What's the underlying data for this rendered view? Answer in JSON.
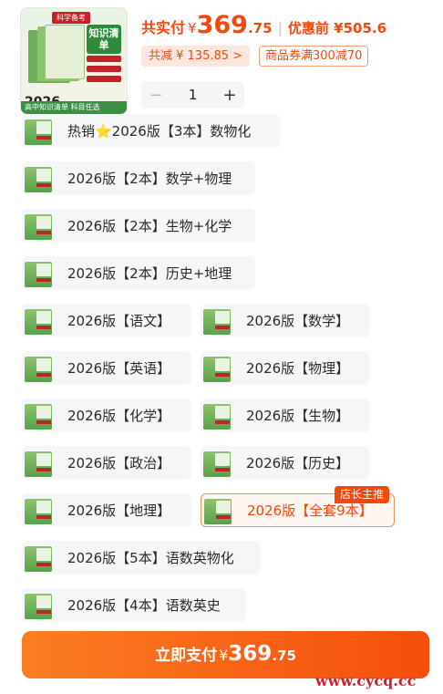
{
  "product": {
    "brand": "科学备考",
    "cover_title": "知识清单",
    "year": "2026",
    "strip_text": "高中知识清单 科目任选"
  },
  "price": {
    "label": "共实付",
    "currency": "¥",
    "integer": "369",
    "decimal": ".75",
    "separator": "|",
    "original_text": "优惠前 ¥505.6",
    "saved_text": "共减 ¥ 135.85 >",
    "coupon_text": "商品券满300减70"
  },
  "quantity": {
    "minus": "−",
    "value": "1",
    "plus": "+"
  },
  "options": [
    {
      "label": "热销⭐2026版【3本】数物化"
    },
    {
      "label": "2026版【2本】数学+物理"
    },
    {
      "label": "2026版【2本】生物+化学"
    },
    {
      "label": "2026版【2本】历史+地理"
    },
    {
      "label": "2026版【语文】"
    },
    {
      "label": "2026版【数学】"
    },
    {
      "label": "2026版【英语】"
    },
    {
      "label": "2026版【物理】"
    },
    {
      "label": "2026版【化学】"
    },
    {
      "label": "2026版【生物】"
    },
    {
      "label": "2026版【政治】"
    },
    {
      "label": "2026版【历史】"
    },
    {
      "label": "2026版【地理】"
    },
    {
      "label": "2026版【全套9本】",
      "selected": true,
      "badge": "店长主推"
    },
    {
      "label": "2026版【5本】语数英物化"
    },
    {
      "label": "2026版【4本】语数英史"
    }
  ],
  "pay_button": {
    "label": "立即支付",
    "currency": "¥",
    "integer": "369",
    "decimal": ".75"
  },
  "watermark": "www.cycq.cc",
  "colors": {
    "accent": "#f3470c",
    "selected_bg": "#fef6f0",
    "chip_bg": "#f5f6f8"
  }
}
